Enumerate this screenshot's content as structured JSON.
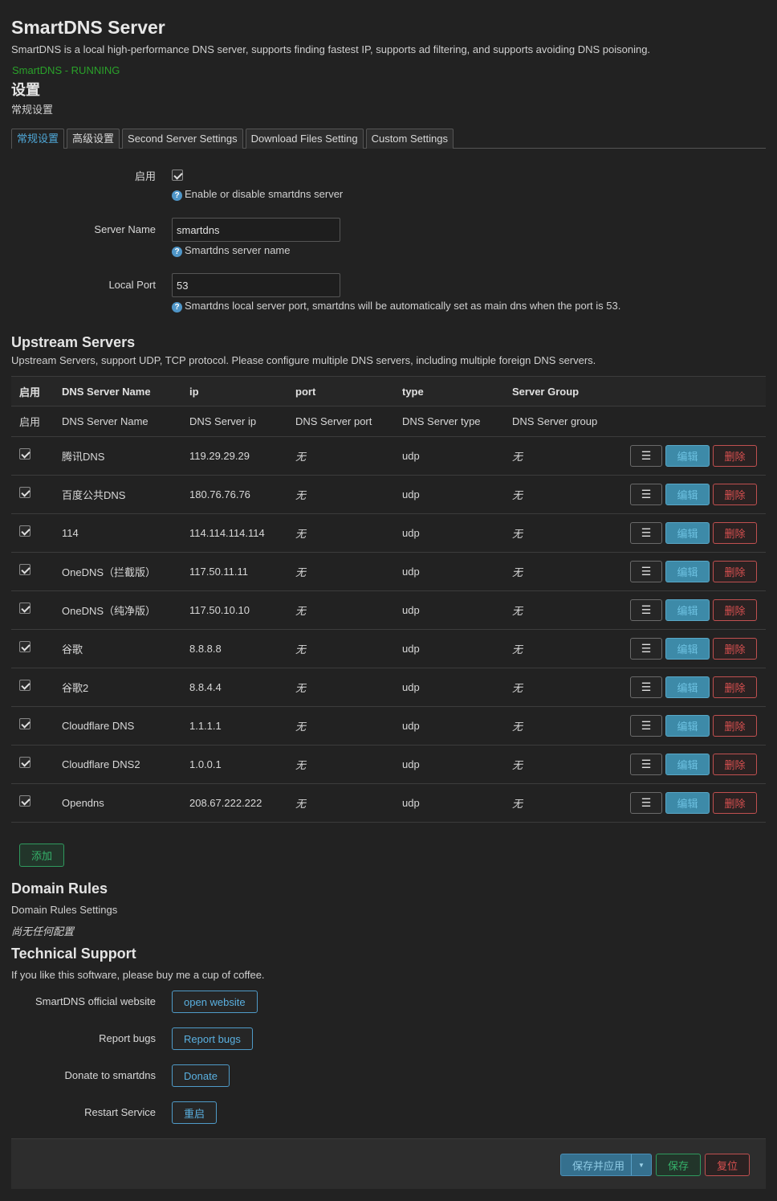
{
  "header": {
    "title": "SmartDNS Server",
    "description": "SmartDNS is a local high-performance DNS server, supports finding fastest IP, supports ad filtering, and supports avoiding DNS poisoning.",
    "status": "SmartDNS - RUNNING",
    "status_color": "#2aa12a"
  },
  "settings": {
    "title": "设置",
    "subtitle": "常规设置",
    "tabs": [
      {
        "label": "常规设置",
        "active": true
      },
      {
        "label": "高级设置",
        "active": false
      },
      {
        "label": "Second Server Settings",
        "active": false
      },
      {
        "label": "Download Files Setting",
        "active": false
      },
      {
        "label": "Custom Settings",
        "active": false
      }
    ],
    "enable": {
      "label": "启用",
      "checked": true,
      "help": "Enable or disable smartdns server"
    },
    "server_name": {
      "label": "Server Name",
      "value": "smartdns",
      "help": "Smartdns server name"
    },
    "local_port": {
      "label": "Local Port",
      "value": "53",
      "help": "Smartdns local server port, smartdns will be automatically set as main dns when the port is 53."
    }
  },
  "upstream": {
    "title": "Upstream Servers",
    "description": "Upstream Servers, support UDP, TCP protocol. Please configure multiple DNS servers, including multiple foreign DNS servers.",
    "headers": [
      "启用",
      "DNS Server Name",
      "ip",
      "port",
      "type",
      "Server Group"
    ],
    "descriptions": [
      "启用",
      "DNS Server Name",
      "DNS Server ip",
      "DNS Server port",
      "DNS Server type",
      "DNS Server group"
    ],
    "rows": [
      {
        "enabled": true,
        "name": "腾讯DNS",
        "ip": "119.29.29.29",
        "port": "无",
        "type": "udp",
        "group": "无"
      },
      {
        "enabled": true,
        "name": "百度公共DNS",
        "ip": "180.76.76.76",
        "port": "无",
        "type": "udp",
        "group": "无"
      },
      {
        "enabled": true,
        "name": "114",
        "ip": "114.114.114.114",
        "port": "无",
        "type": "udp",
        "group": "无"
      },
      {
        "enabled": true,
        "name": "OneDNS（拦截版）",
        "ip": "117.50.11.11",
        "port": "无",
        "type": "udp",
        "group": "无"
      },
      {
        "enabled": true,
        "name": "OneDNS（纯净版）",
        "ip": "117.50.10.10",
        "port": "无",
        "type": "udp",
        "group": "无"
      },
      {
        "enabled": true,
        "name": "谷歌",
        "ip": "8.8.8.8",
        "port": "无",
        "type": "udp",
        "group": "无"
      },
      {
        "enabled": true,
        "name": "谷歌2",
        "ip": "8.8.4.4",
        "port": "无",
        "type": "udp",
        "group": "无"
      },
      {
        "enabled": true,
        "name": "Cloudflare DNS",
        "ip": "1.1.1.1",
        "port": "无",
        "type": "udp",
        "group": "无"
      },
      {
        "enabled": true,
        "name": "Cloudflare DNS2",
        "ip": "1.0.0.1",
        "port": "无",
        "type": "udp",
        "group": "无"
      },
      {
        "enabled": true,
        "name": "Opendns",
        "ip": "208.67.222.222",
        "port": "无",
        "type": "udp",
        "group": "无"
      }
    ],
    "row_actions": {
      "menu": "☰",
      "edit": "编辑",
      "delete": "删除"
    },
    "add_label": "添加"
  },
  "domain_rules": {
    "title": "Domain Rules",
    "subtitle": "Domain Rules Settings",
    "empty": "尚无任何配置"
  },
  "support": {
    "title": "Technical Support",
    "description": "If you like this software, please buy me a cup of coffee.",
    "items": [
      {
        "label": "SmartDNS official website",
        "button": "open website"
      },
      {
        "label": "Report bugs",
        "button": "Report bugs"
      },
      {
        "label": "Donate to smartdns",
        "button": "Donate"
      },
      {
        "label": "Restart Service",
        "button": "重启"
      }
    ]
  },
  "footer": {
    "save_apply": "保存并应用",
    "save": "保存",
    "reset": "复位"
  }
}
